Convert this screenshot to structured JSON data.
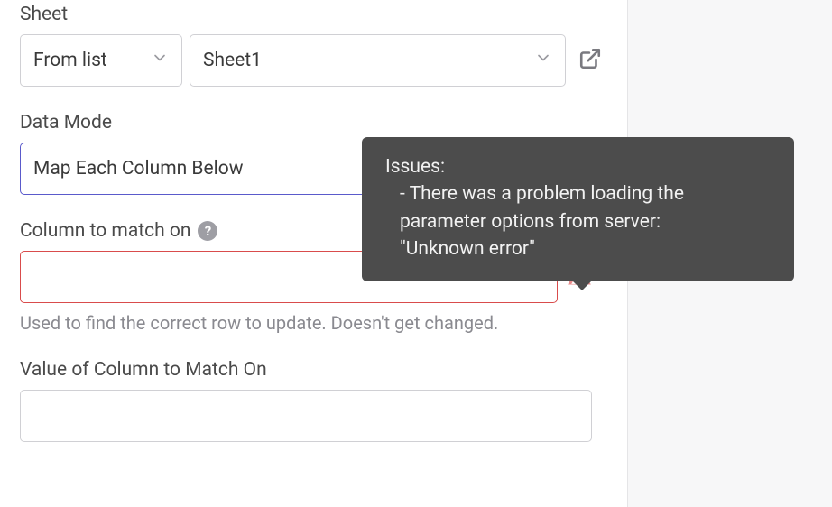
{
  "sheet": {
    "label": "Sheet",
    "mode_value": "From list",
    "name_value": "Sheet1"
  },
  "data_mode": {
    "label": "Data Mode",
    "value": "Map Each Column Below"
  },
  "column_match": {
    "label": "Column to match on",
    "value": "",
    "helper": "Used to find the correct row to update. Doesn't get changed."
  },
  "value_match": {
    "label": "Value of Column to Match On",
    "value": ""
  },
  "tooltip": {
    "heading": "Issues:",
    "line1": " - There was a problem loading the",
    "line2": "parameter options from server:",
    "line3": "\"Unknown error\""
  }
}
